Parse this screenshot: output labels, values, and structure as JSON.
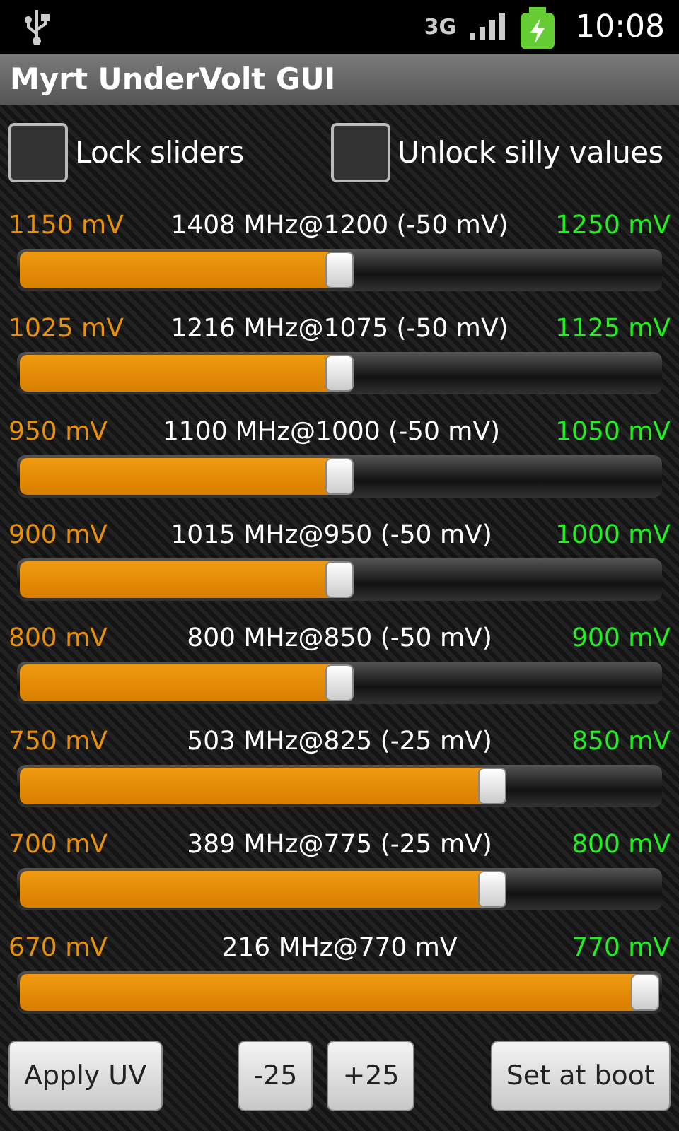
{
  "status_bar": {
    "network": "3G",
    "time": "10:08"
  },
  "title": "Myrt UnderVolt GUI",
  "options": [
    {
      "label": "Lock sliders",
      "checked": false
    },
    {
      "label": "Unlock silly values",
      "checked": false
    }
  ],
  "sliders": [
    {
      "min": "1150 mV",
      "caption": "1408 MHz@1200 (-50 mV)",
      "max": "1250 mV",
      "level": 0.5
    },
    {
      "min": "1025 mV",
      "caption": "1216 MHz@1075 (-50 mV)",
      "max": "1125 mV",
      "level": 0.5
    },
    {
      "min": "950 mV",
      "caption": "1100 MHz@1000 (-50 mV)",
      "max": "1050 mV",
      "level": 0.5
    },
    {
      "min": "900 mV",
      "caption": "1015 MHz@950 (-50 mV)",
      "max": "1000 mV",
      "level": 0.5
    },
    {
      "min": "800 mV",
      "caption": "800 MHz@850 (-50 mV)",
      "max": "900 mV",
      "level": 0.5
    },
    {
      "min": "750 mV",
      "caption": "503 MHz@825 (-25 mV)",
      "max": "850 mV",
      "level": 0.75
    },
    {
      "min": "700 mV",
      "caption": "389 MHz@775 (-25 mV)",
      "max": "800 mV",
      "level": 0.75
    },
    {
      "min": "670 mV",
      "caption": "216 MHz@770 mV",
      "max": "770 mV",
      "level": 1.0
    }
  ],
  "buttons": [
    "Apply UV",
    "-25",
    "+25",
    "Set at boot"
  ]
}
